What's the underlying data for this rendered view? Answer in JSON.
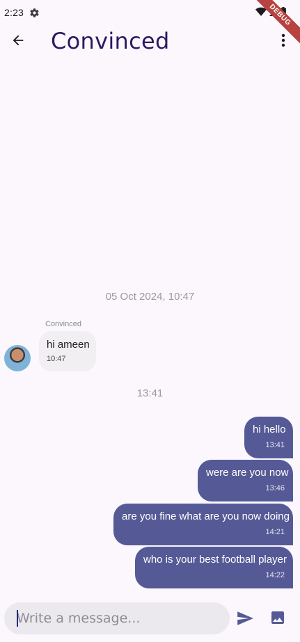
{
  "status_bar": {
    "time": "2:23",
    "debug_label": "DEBUG"
  },
  "app_bar": {
    "title": "Convinced"
  },
  "chat": {
    "date_separator_1": "05 Oct 2024, 10:47",
    "incoming": {
      "sender": "Convinced",
      "message": "hi ameen",
      "time": "10:47"
    },
    "date_separator_2": "13:41",
    "outgoing": [
      {
        "message": "hi hello",
        "time": "13:41"
      },
      {
        "message": "were are you now",
        "time": "13:46"
      },
      {
        "message": "are you fine what are you now doing",
        "time": "14:21"
      },
      {
        "message": "who is your best football player",
        "time": "14:22"
      }
    ]
  },
  "composer": {
    "placeholder": "Write a message...",
    "value": ""
  },
  "colors": {
    "background": "#fbf7fd",
    "outgoing_bubble": "#555a96",
    "incoming_bubble": "#f1eff2",
    "title": "#2a1a5e"
  },
  "icons": [
    "settings-icon",
    "wifi-icon",
    "signal-icon",
    "battery-icon",
    "arrow-back-icon",
    "more-vert-icon",
    "send-icon",
    "image-icon"
  ]
}
